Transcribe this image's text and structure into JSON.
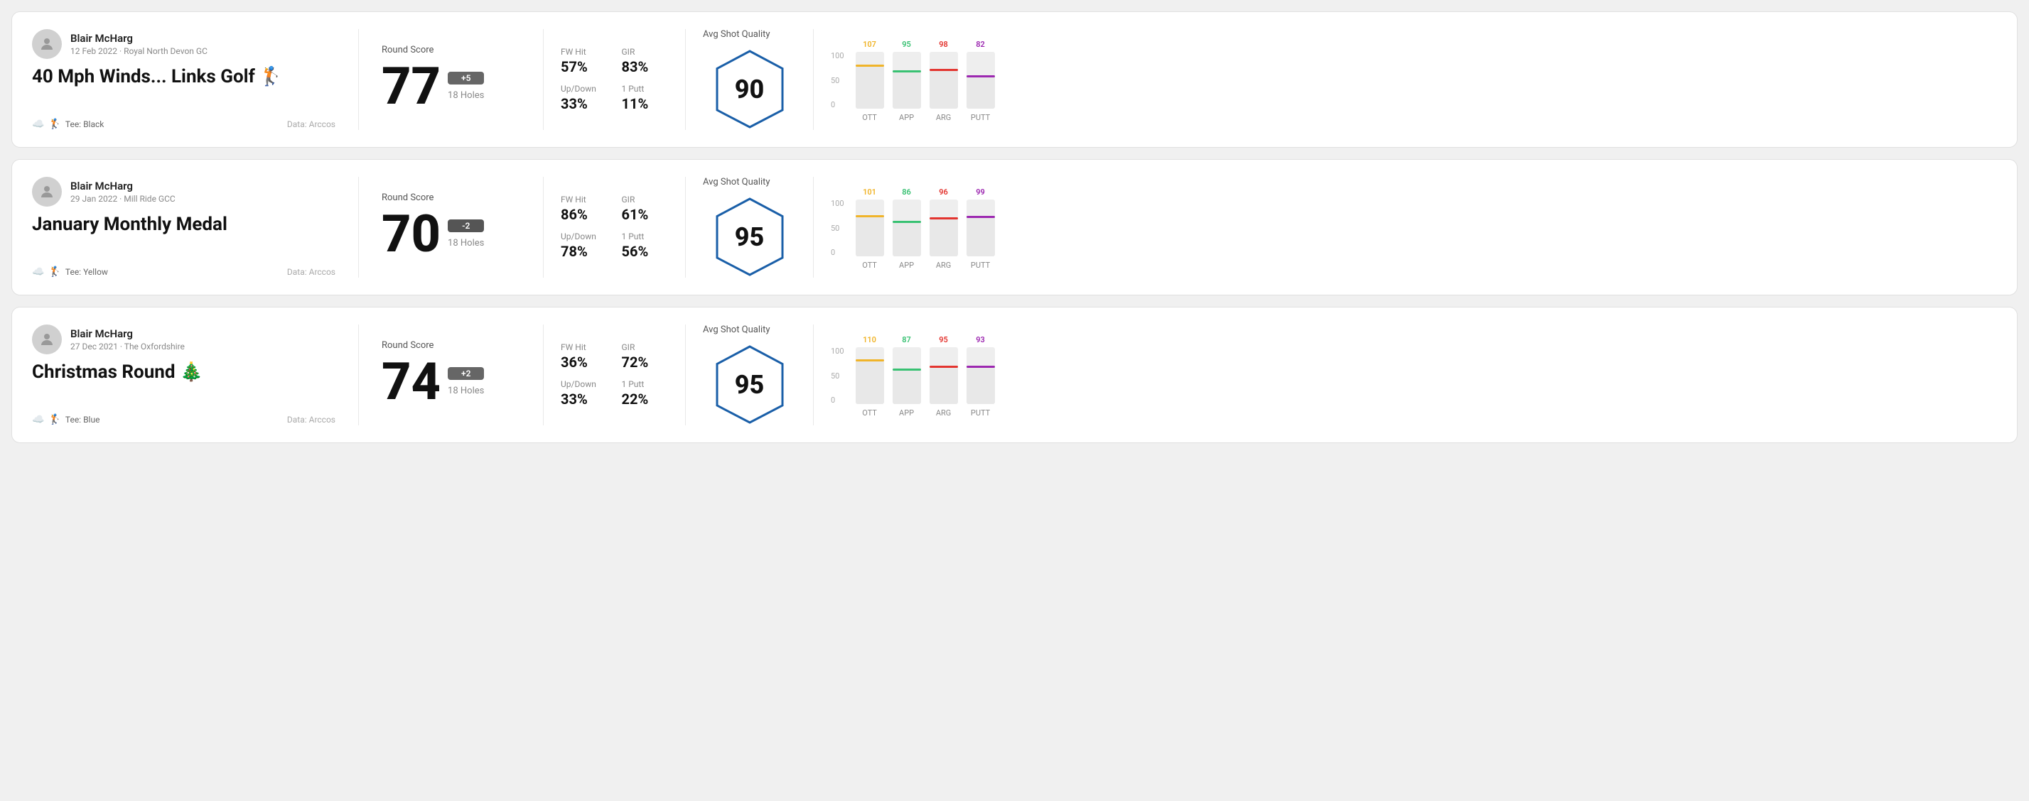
{
  "rounds": [
    {
      "id": "round1",
      "user_name": "Blair McHarg",
      "date_course": "12 Feb 2022 · Royal North Devon GC",
      "title": "40 Mph Winds... Links Golf 🏌️",
      "tee": "Tee: Black",
      "data_source": "Data: Arccos",
      "score": "77",
      "score_diff": "+5",
      "score_diff_type": "positive",
      "holes": "18 Holes",
      "fw_hit": "57%",
      "gir": "83%",
      "up_down": "33%",
      "one_putt": "11%",
      "avg_quality": "90",
      "chart": {
        "ott": {
          "value": 107,
          "color": "#f0b429",
          "pct": 78
        },
        "app": {
          "value": 95,
          "color": "#38c172",
          "pct": 68
        },
        "arg": {
          "value": 98,
          "color": "#e3342f",
          "pct": 70
        },
        "putt": {
          "value": 82,
          "color": "#9c27b0",
          "pct": 59
        }
      }
    },
    {
      "id": "round2",
      "user_name": "Blair McHarg",
      "date_course": "29 Jan 2022 · Mill Ride GCC",
      "title": "January Monthly Medal",
      "tee": "Tee: Yellow",
      "data_source": "Data: Arccos",
      "score": "70",
      "score_diff": "-2",
      "score_diff_type": "negative",
      "holes": "18 Holes",
      "fw_hit": "86%",
      "gir": "61%",
      "up_down": "78%",
      "one_putt": "56%",
      "avg_quality": "95",
      "chart": {
        "ott": {
          "value": 101,
          "color": "#f0b429",
          "pct": 73
        },
        "app": {
          "value": 86,
          "color": "#38c172",
          "pct": 62
        },
        "arg": {
          "value": 96,
          "color": "#e3342f",
          "pct": 69
        },
        "putt": {
          "value": 99,
          "color": "#9c27b0",
          "pct": 71
        }
      }
    },
    {
      "id": "round3",
      "user_name": "Blair McHarg",
      "date_course": "27 Dec 2021 · The Oxfordshire",
      "title": "Christmas Round 🎄",
      "tee": "Tee: Blue",
      "data_source": "Data: Arccos",
      "score": "74",
      "score_diff": "+2",
      "score_diff_type": "positive",
      "holes": "18 Holes",
      "fw_hit": "36%",
      "gir": "72%",
      "up_down": "33%",
      "one_putt": "22%",
      "avg_quality": "95",
      "chart": {
        "ott": {
          "value": 110,
          "color": "#f0b429",
          "pct": 79
        },
        "app": {
          "value": 87,
          "color": "#38c172",
          "pct": 63
        },
        "arg": {
          "value": 95,
          "color": "#e3342f",
          "pct": 68
        },
        "putt": {
          "value": 93,
          "color": "#9c27b0",
          "pct": 67
        }
      }
    }
  ],
  "labels": {
    "round_score": "Round Score",
    "avg_quality": "Avg Shot Quality",
    "fw_hit": "FW Hit",
    "gir": "GIR",
    "up_down": "Up/Down",
    "one_putt": "1 Putt",
    "ott": "OTT",
    "app": "APP",
    "arg": "ARG",
    "putt": "PUTT",
    "y100": "100",
    "y50": "50",
    "y0": "0"
  }
}
